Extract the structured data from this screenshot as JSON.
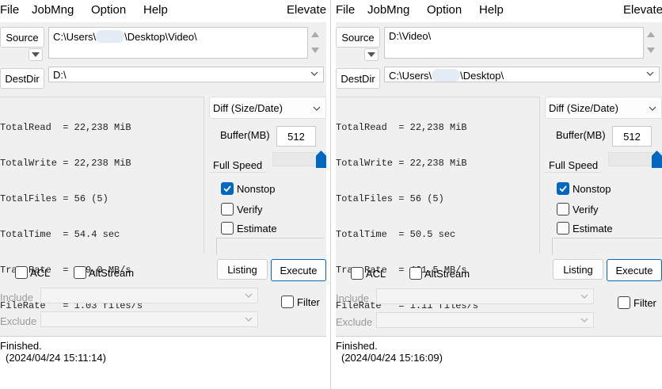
{
  "panes": [
    {
      "menu": {
        "file": "File",
        "jobmng": "JobMng",
        "option": "Option",
        "help": "Help",
        "elevate": "Elevate"
      },
      "source": {
        "label": "Source",
        "value_prefix": "C:\\Users\\",
        "value_suffix": "\\Desktop\\Video\\"
      },
      "destdir": {
        "label": "DestDir",
        "value_prefix": "D:\\",
        "value_suffix": ""
      },
      "stats": {
        "lines": [
          "TotalRead  = 22,238 MiB",
          "TotalWrite = 22,238 MiB",
          "TotalFiles = 56 (5)",
          "TotalTime  = 54.4 sec",
          "TransRate  = 429.0 MB/s",
          "FileRate   = 1.03 files/s"
        ]
      },
      "mode": "Diff (Size/Date)",
      "buffer": {
        "label": "Buffer(MB)",
        "value": "512"
      },
      "speed": "Full Speed",
      "options": {
        "nonstop": "Nonstop",
        "verify": "Verify",
        "estimate": "Estimate"
      },
      "listing": "Listing",
      "execute": "Execute",
      "acl": "ACL",
      "altstream": "AltStream",
      "include": "Include",
      "exclude": "Exclude",
      "filter": "Filter",
      "status": {
        "line1": "Finished.",
        "line2": "(2024/04/24 15:11:14)"
      }
    },
    {
      "menu": {
        "file": "File",
        "jobmng": "JobMng",
        "option": "Option",
        "help": "Help",
        "elevate": "Elevate"
      },
      "source": {
        "label": "Source",
        "value_prefix": "D:\\Video\\",
        "value_suffix": ""
      },
      "destdir": {
        "label": "DestDir",
        "value_prefix": "C:\\Users\\",
        "value_suffix": "\\Desktop\\"
      },
      "stats": {
        "lines": [
          "TotalRead  = 22,238 MiB",
          "TotalWrite = 22,238 MiB",
          "TotalFiles = 56 (5)",
          "TotalTime  = 50.5 sec",
          "TransRate  = 461.5 MB/s",
          "FileRate   = 1.11 files/s"
        ]
      },
      "mode": "Diff (Size/Date)",
      "buffer": {
        "label": "Buffer(MB)",
        "value": "512"
      },
      "speed": "Full Speed",
      "options": {
        "nonstop": "Nonstop",
        "verify": "Verify",
        "estimate": "Estimate"
      },
      "listing": "Listing",
      "execute": "Execute",
      "acl": "ACL",
      "altstream": "AltStream",
      "include": "Include",
      "exclude": "Exclude",
      "filter": "Filter",
      "status": {
        "line1": "Finished.",
        "line2": "(2024/04/24 15:16:09)"
      }
    }
  ],
  "colors": {
    "accent": "#0067c0",
    "background": "#f0f0f0"
  },
  "icons": {
    "dropdown": "chevron-down-icon",
    "scroll_up": "triangle-up-icon",
    "scroll_down": "triangle-down-icon",
    "check": "check-icon"
  }
}
